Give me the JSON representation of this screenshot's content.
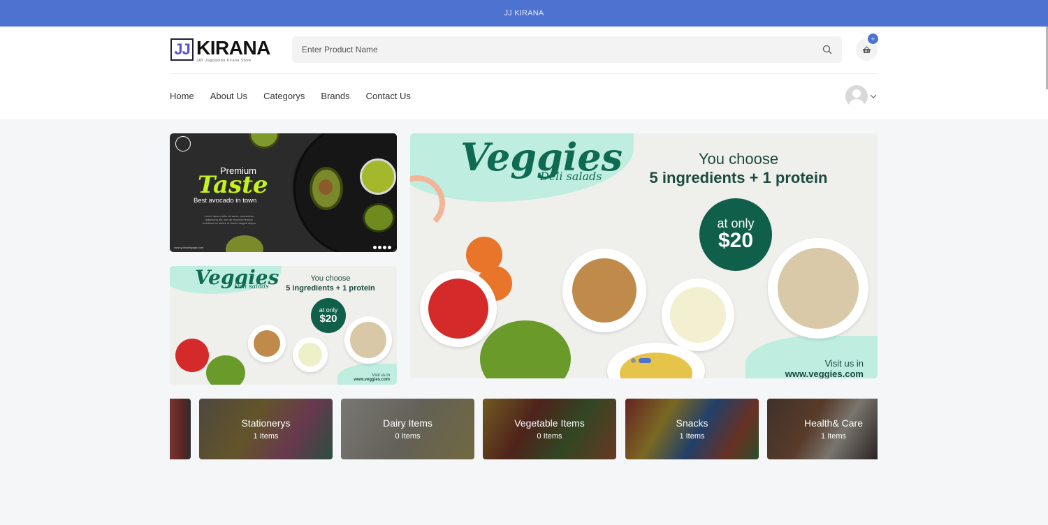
{
  "topbar": {
    "title": "JJ KIRANA"
  },
  "logo": {
    "mark": "JJ",
    "word": "KIRANA",
    "tagline": "JAY Jagdamba Kirana Store"
  },
  "search": {
    "placeholder": "Enter Product Name",
    "value": ""
  },
  "cart": {
    "badge": "+"
  },
  "nav": {
    "items": [
      "Home",
      "About Us",
      "Categorys",
      "Brands",
      "Contact Us"
    ]
  },
  "banners": {
    "taste": {
      "premium": "Premium",
      "taste": "Taste",
      "best": "Best avocado in town",
      "lorem": "Lorem ipsum dolor sit amet, consectetur adipiscing elit, sed do eiusmod tempor incididunt ut labore et dolore magna aliqua",
      "web": "www.yourwebpage.com"
    },
    "veggies_small": {
      "title": "Veggies",
      "sub": "Deli salads",
      "choose_1": "You choose",
      "choose_2": "5 ingredients + 1 protein",
      "price_1": "at only",
      "price_2": "$20",
      "visit_1": "Visit us in",
      "visit_2": "www.veggies.com"
    },
    "veggies_large": {
      "title": "Veggies",
      "sub": "Deli salads",
      "choose_1": "You choose",
      "choose_2": "5 ingredients + 1 protein",
      "price_1": "at only",
      "price_2": "$20",
      "visit_1": "Visit us in",
      "visit_2": "www.veggies.com"
    }
  },
  "carousel": {
    "active_index": 1,
    "count": 2
  },
  "categories": [
    {
      "name": "Stationerys",
      "count": "1 Items",
      "color": "#7a6a5a"
    },
    {
      "name": "Dairy Items",
      "count": "0 Items",
      "color": "#8a8a84"
    },
    {
      "name": "Vegetable Items",
      "count": "0 Items",
      "color": "#6a5a2a"
    },
    {
      "name": "Snacks",
      "count": "1 Items",
      "color": "#7a4a3a"
    },
    {
      "name": "Health& Care",
      "count": "1 Items",
      "color": "#5a4034"
    }
  ],
  "colors": {
    "accent": "#4d72cf",
    "brand_green": "#0f5f4a",
    "mint": "#bfeee0",
    "lime": "#c6f21b"
  }
}
